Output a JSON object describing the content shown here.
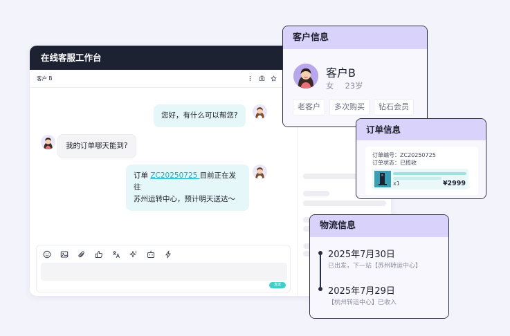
{
  "workstation": {
    "title": "在线客服工作台",
    "customer_label": "客户 B",
    "toolbar_icons": [
      "more-vertical-icon",
      "transfer-icon",
      "star-icon",
      "document-icon"
    ]
  },
  "chat": {
    "messages": [
      {
        "from": "agent",
        "text": "您好，有什么可以帮您?"
      },
      {
        "from": "customer",
        "text": "我的订单哪天能到?"
      },
      {
        "from": "agent",
        "prefix": "订单 ",
        "order_no": "ZC20250725 ",
        "line1_suffix": "目前正在发往",
        "line2": "苏州运转中心，预计明天送达～"
      }
    ]
  },
  "input": {
    "tools": [
      "emoji-icon",
      "image-icon",
      "attachment-icon",
      "thumbs-up-icon",
      "translate-icon",
      "ai-sparkle-icon",
      "robot-icon",
      "lightning-icon"
    ],
    "send_label": "发送"
  },
  "customer_card": {
    "title": "客户信息",
    "name": "客户B",
    "gender": "女",
    "age": "23岁",
    "tags": [
      "老客户",
      "多次购买",
      "钻石会员"
    ]
  },
  "order_card": {
    "title": "订单信息",
    "order_no_line": "订单编号：ZC20250725",
    "status_line": "订单状态：已揽收",
    "quantity": "x1",
    "price": "¥2999"
  },
  "logistics_card": {
    "title": "物流信息",
    "events": [
      {
        "date": "2025年7月30日",
        "status": "已出发，下一站【苏州转运中心】"
      },
      {
        "date": "2025年7月29日",
        "status": "【杭州转运中心】已收入"
      }
    ]
  },
  "colors": {
    "header_dark": "#1d2233",
    "card_header": "#d9d2fa",
    "agent_bubble": "#e6f7f9",
    "link": "#1aa7c2",
    "send_button": "#3ed0c8"
  }
}
